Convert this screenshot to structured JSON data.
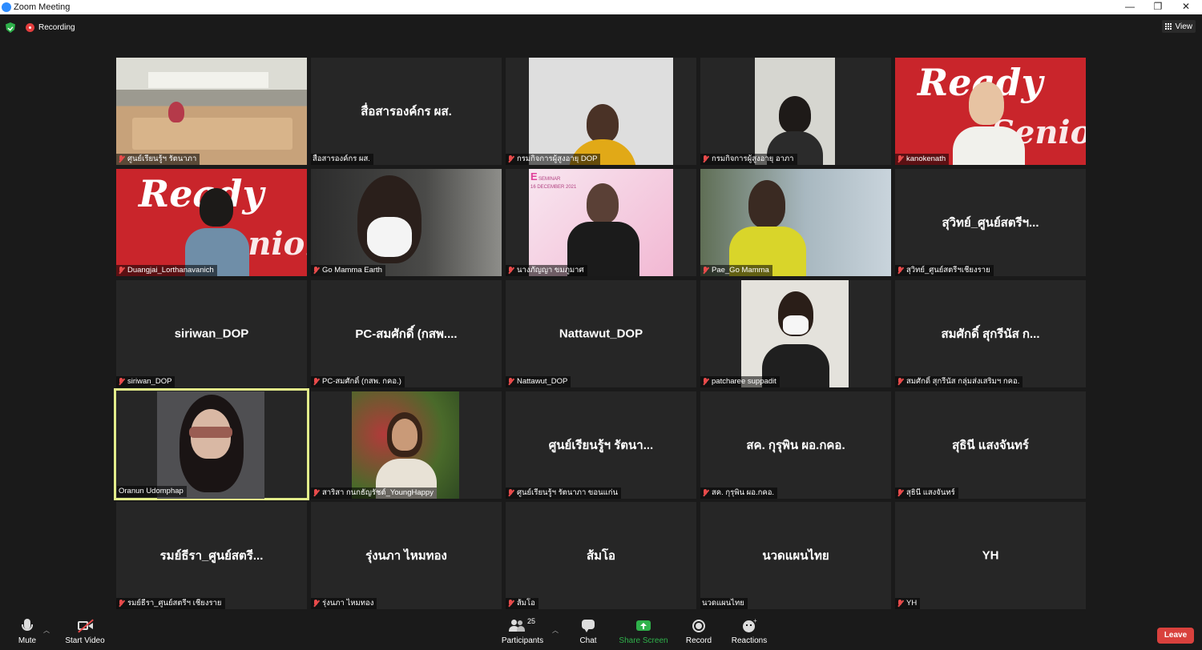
{
  "window": {
    "title": "Zoom Meeting",
    "minimize": "—",
    "restore": "❐",
    "close": "✕"
  },
  "status": {
    "recording": "Recording",
    "view": "View"
  },
  "tiles": [
    {
      "label": "ศูนย์เรียนรู้ฯ รัตนาภา",
      "big": ""
    },
    {
      "label": "สื่อสารองค์กร ผส.",
      "big": "สื่อสารองค์กร ผส."
    },
    {
      "label": "กรมกิจการผู้สูงอายุ DOP",
      "big": ""
    },
    {
      "label": "กรมกิจการผู้สูงอายุ อาภา",
      "big": ""
    },
    {
      "label": "kanokenath",
      "big": ""
    },
    {
      "label": "Duangjai_Lorthanavanich",
      "big": ""
    },
    {
      "label": "Go Mamma Earth",
      "big": ""
    },
    {
      "label": "นางภัญญา ขมภูมาศ",
      "big": ""
    },
    {
      "label": "Pae_Go Mamma",
      "big": ""
    },
    {
      "label": "สุวิทย์_ศูนย์สตรีฯเชียงราย",
      "big": "สุวิทย์_ศูนย์สตรีฯ..."
    },
    {
      "label": "siriwan_DOP",
      "big": "siriwan_DOP"
    },
    {
      "label": "PC-สมศักดิ์ (กสพ. กคอ.)",
      "big": "PC-สมศักดิ์ (กสพ...."
    },
    {
      "label": "Nattawut_DOP",
      "big": "Nattawut_DOP"
    },
    {
      "label": "patcharee suppadit",
      "big": ""
    },
    {
      "label": "สมศักดิ์ สุกรีนัส กลุ่มส่งเสริมฯ กคอ.",
      "big": "สมศักดิ์ สุกรีนัส ก..."
    },
    {
      "label": "Oranun Udomphap",
      "big": ""
    },
    {
      "label": "สาริสา กนกธัญรัชต์_YoungHappy",
      "big": ""
    },
    {
      "label": "ศูนย์เรียนรู้ฯ รัตนาภา  ขอนแก่น",
      "big": "ศูนย์เรียนรู้ฯ รัตนา..."
    },
    {
      "label": "สค. กุรุพิน ผอ.กคอ.",
      "big": "สค. กุรุพิน ผอ.กคอ."
    },
    {
      "label": "สุธินี แสงจันทร์",
      "big": "สุธินี แสงจันทร์"
    },
    {
      "label": "รมย์ธีรา_ศูนย์สตรีฯ เชียงราย",
      "big": "รมย์ธีรา_ศูนย์สตรี..."
    },
    {
      "label": "รุ่งนภา ไหมทอง",
      "big": "รุ่งนภา ไหมทอง"
    },
    {
      "label": "ส้มโอ",
      "big": "ส้มโอ"
    },
    {
      "label": "นวดแผนไทย",
      "big": "นวดแผนไทย"
    },
    {
      "label": "YH",
      "big": "YH"
    }
  ],
  "video_text": {
    "ready_1": "Ready",
    "ready_2": "Senior",
    "seminar_1": "E",
    "seminar_2": "SEMINAR",
    "seminar_3": "16 DECEMBER 2021"
  },
  "toolbar": {
    "mute": "Mute",
    "start_video": "Start Video",
    "participants": "Participants",
    "participants_count": "25",
    "chat": "Chat",
    "share_screen": "Share Screen",
    "record": "Record",
    "reactions": "Reactions",
    "leave": "Leave"
  },
  "colors": {
    "share_green": "#2fb24b",
    "leave_red": "#d9413d",
    "active_speaker": "#e2ec8a"
  }
}
